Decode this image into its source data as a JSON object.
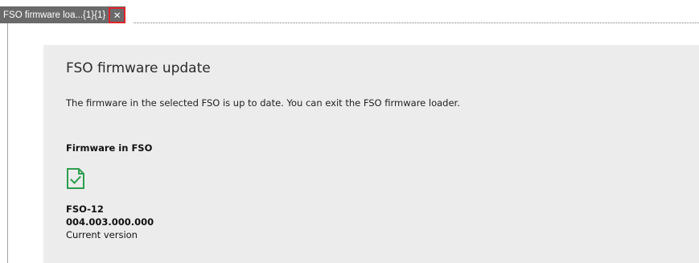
{
  "tab": {
    "label": "FSO firmware loa...{1}{1}",
    "close_glyph": "✕",
    "close_icon": "close-icon"
  },
  "panel": {
    "title": "FSO firmware update",
    "message": "The firmware in the selected FSO is up to date. You can exit the FSO firmware loader.",
    "section_heading": "Firmware in FSO",
    "firmware": {
      "icon": "document-check-icon",
      "name": "FSO-12",
      "version": "004.003.000.000",
      "status": "Current version"
    }
  },
  "colors": {
    "tab_background": "#6a6a6a",
    "close_highlight": "#e0242b",
    "panel_background": "#ececec",
    "check_green": "#2e9e4f"
  }
}
